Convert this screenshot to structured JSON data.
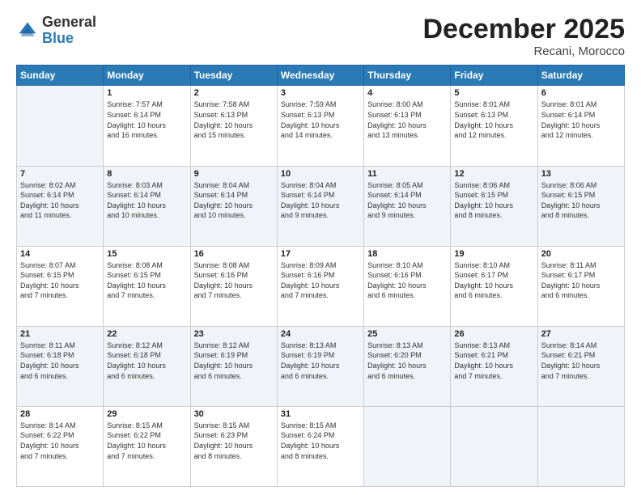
{
  "header": {
    "logo_general": "General",
    "logo_blue": "Blue",
    "title": "December 2025",
    "subtitle": "Recani, Morocco"
  },
  "columns": [
    "Sunday",
    "Monday",
    "Tuesday",
    "Wednesday",
    "Thursday",
    "Friday",
    "Saturday"
  ],
  "weeks": [
    [
      {
        "day": "",
        "info": ""
      },
      {
        "day": "1",
        "info": "Sunrise: 7:57 AM\nSunset: 6:14 PM\nDaylight: 10 hours\nand 16 minutes."
      },
      {
        "day": "2",
        "info": "Sunrise: 7:58 AM\nSunset: 6:13 PM\nDaylight: 10 hours\nand 15 minutes."
      },
      {
        "day": "3",
        "info": "Sunrise: 7:59 AM\nSunset: 6:13 PM\nDaylight: 10 hours\nand 14 minutes."
      },
      {
        "day": "4",
        "info": "Sunrise: 8:00 AM\nSunset: 6:13 PM\nDaylight: 10 hours\nand 13 minutes."
      },
      {
        "day": "5",
        "info": "Sunrise: 8:01 AM\nSunset: 6:13 PM\nDaylight: 10 hours\nand 12 minutes."
      },
      {
        "day": "6",
        "info": "Sunrise: 8:01 AM\nSunset: 6:14 PM\nDaylight: 10 hours\nand 12 minutes."
      }
    ],
    [
      {
        "day": "7",
        "info": "Sunrise: 8:02 AM\nSunset: 6:14 PM\nDaylight: 10 hours\nand 11 minutes."
      },
      {
        "day": "8",
        "info": "Sunrise: 8:03 AM\nSunset: 6:14 PM\nDaylight: 10 hours\nand 10 minutes."
      },
      {
        "day": "9",
        "info": "Sunrise: 8:04 AM\nSunset: 6:14 PM\nDaylight: 10 hours\nand 10 minutes."
      },
      {
        "day": "10",
        "info": "Sunrise: 8:04 AM\nSunset: 6:14 PM\nDaylight: 10 hours\nand 9 minutes."
      },
      {
        "day": "11",
        "info": "Sunrise: 8:05 AM\nSunset: 6:14 PM\nDaylight: 10 hours\nand 9 minutes."
      },
      {
        "day": "12",
        "info": "Sunrise: 8:06 AM\nSunset: 6:15 PM\nDaylight: 10 hours\nand 8 minutes."
      },
      {
        "day": "13",
        "info": "Sunrise: 8:06 AM\nSunset: 6:15 PM\nDaylight: 10 hours\nand 8 minutes."
      }
    ],
    [
      {
        "day": "14",
        "info": "Sunrise: 8:07 AM\nSunset: 6:15 PM\nDaylight: 10 hours\nand 7 minutes."
      },
      {
        "day": "15",
        "info": "Sunrise: 8:08 AM\nSunset: 6:15 PM\nDaylight: 10 hours\nand 7 minutes."
      },
      {
        "day": "16",
        "info": "Sunrise: 8:08 AM\nSunset: 6:16 PM\nDaylight: 10 hours\nand 7 minutes."
      },
      {
        "day": "17",
        "info": "Sunrise: 8:09 AM\nSunset: 6:16 PM\nDaylight: 10 hours\nand 7 minutes."
      },
      {
        "day": "18",
        "info": "Sunrise: 8:10 AM\nSunset: 6:16 PM\nDaylight: 10 hours\nand 6 minutes."
      },
      {
        "day": "19",
        "info": "Sunrise: 8:10 AM\nSunset: 6:17 PM\nDaylight: 10 hours\nand 6 minutes."
      },
      {
        "day": "20",
        "info": "Sunrise: 8:11 AM\nSunset: 6:17 PM\nDaylight: 10 hours\nand 6 minutes."
      }
    ],
    [
      {
        "day": "21",
        "info": "Sunrise: 8:11 AM\nSunset: 6:18 PM\nDaylight: 10 hours\nand 6 minutes."
      },
      {
        "day": "22",
        "info": "Sunrise: 8:12 AM\nSunset: 6:18 PM\nDaylight: 10 hours\nand 6 minutes."
      },
      {
        "day": "23",
        "info": "Sunrise: 8:12 AM\nSunset: 6:19 PM\nDaylight: 10 hours\nand 6 minutes."
      },
      {
        "day": "24",
        "info": "Sunrise: 8:13 AM\nSunset: 6:19 PM\nDaylight: 10 hours\nand 6 minutes."
      },
      {
        "day": "25",
        "info": "Sunrise: 8:13 AM\nSunset: 6:20 PM\nDaylight: 10 hours\nand 6 minutes."
      },
      {
        "day": "26",
        "info": "Sunrise: 8:13 AM\nSunset: 6:21 PM\nDaylight: 10 hours\nand 7 minutes."
      },
      {
        "day": "27",
        "info": "Sunrise: 8:14 AM\nSunset: 6:21 PM\nDaylight: 10 hours\nand 7 minutes."
      }
    ],
    [
      {
        "day": "28",
        "info": "Sunrise: 8:14 AM\nSunset: 6:22 PM\nDaylight: 10 hours\nand 7 minutes."
      },
      {
        "day": "29",
        "info": "Sunrise: 8:15 AM\nSunset: 6:22 PM\nDaylight: 10 hours\nand 7 minutes."
      },
      {
        "day": "30",
        "info": "Sunrise: 8:15 AM\nSunset: 6:23 PM\nDaylight: 10 hours\nand 8 minutes."
      },
      {
        "day": "31",
        "info": "Sunrise: 8:15 AM\nSunset: 6:24 PM\nDaylight: 10 hours\nand 8 minutes."
      },
      {
        "day": "",
        "info": ""
      },
      {
        "day": "",
        "info": ""
      },
      {
        "day": "",
        "info": ""
      }
    ]
  ]
}
